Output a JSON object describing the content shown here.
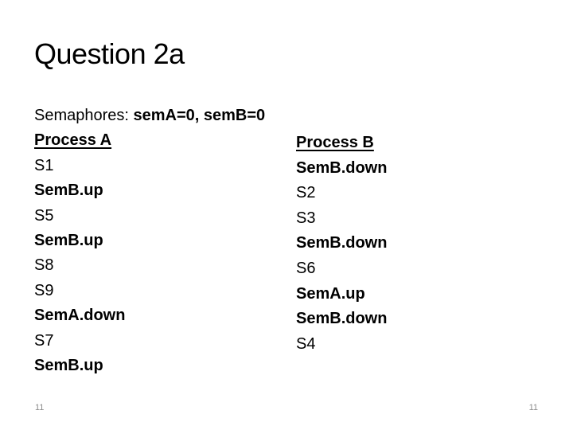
{
  "slide": {
    "title": "Question 2a",
    "semaphores": {
      "label": "Semaphores: ",
      "value": "semA=0, semB=0"
    },
    "process_a": {
      "heading": "Process A",
      "steps": [
        {
          "text": "S1",
          "bold": false
        },
        {
          "text": "SemB.up",
          "bold": true
        },
        {
          "text": "S5",
          "bold": false
        },
        {
          "text": "SemB.up",
          "bold": true
        },
        {
          "text": "S8",
          "bold": false
        },
        {
          "text": "S9",
          "bold": false
        },
        {
          "text": "SemA.down",
          "bold": true
        },
        {
          "text": "S7",
          "bold": false
        },
        {
          "text": "SemB.up",
          "bold": true
        }
      ]
    },
    "process_b": {
      "heading": "Process B",
      "steps": [
        {
          "text": "SemB.down",
          "bold": true
        },
        {
          "text": "S2",
          "bold": false
        },
        {
          "text": "S3",
          "bold": false
        },
        {
          "text": "SemB.down",
          "bold": true
        },
        {
          "text": "S6",
          "bold": false
        },
        {
          "text": "SemA.up",
          "bold": true
        },
        {
          "text": "SemB.down",
          "bold": true
        },
        {
          "text": "S4",
          "bold": false
        }
      ]
    },
    "footer": {
      "left_number": "11",
      "right_number": "11"
    }
  }
}
